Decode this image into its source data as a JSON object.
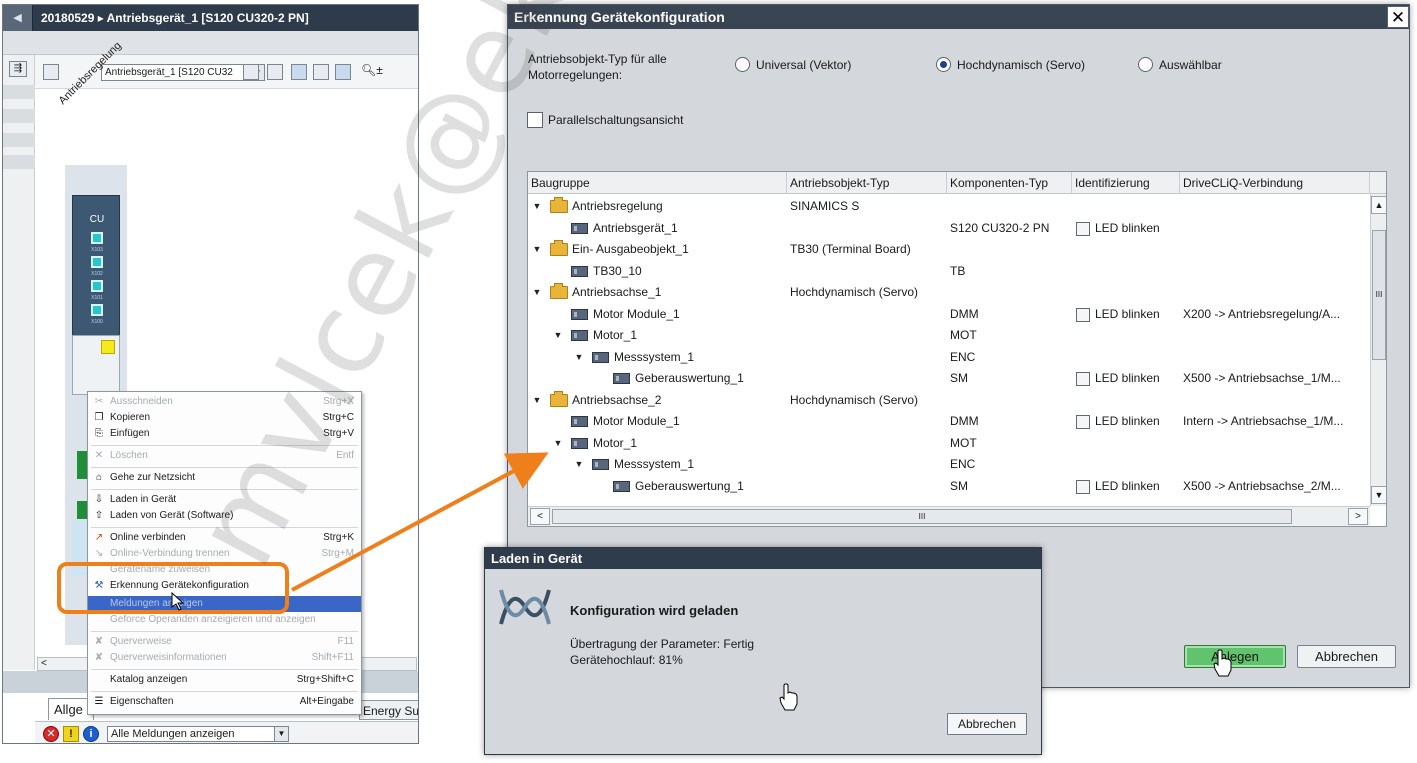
{
  "left_window": {
    "title": "20180529 ▸ Antriebsgerät_1 [S120 CU320-2 PN]",
    "collapse_glyph": "◀",
    "device_select": "Antriebsgerät_1 [S120 CU32",
    "rotated_label": "Antriebsregelung",
    "cu_label": "CU",
    "ports": [
      "X103",
      "X102",
      "X101",
      "X100"
    ],
    "inspector_tab": "Allge",
    "energy_tab": "Energy Su",
    "message_filter": "Alle Meldungen anzeigen",
    "hscroll_left": "<"
  },
  "context_menu": {
    "items": [
      {
        "icon": "✂",
        "label": "Ausschneiden",
        "shortcut": "Strg+X",
        "disabled": true
      },
      {
        "icon": "❐",
        "label": "Kopieren",
        "shortcut": "Strg+C",
        "disabled": false
      },
      {
        "icon": "⎘",
        "label": "Einfügen",
        "shortcut": "Strg+V",
        "disabled": false
      },
      {
        "icon": "✕",
        "label": "Löschen",
        "shortcut": "Entf",
        "disabled": true
      },
      {
        "icon": "⌂",
        "label": "Gehe zur Netzsicht",
        "shortcut": "",
        "disabled": false
      },
      {
        "icon": "⇩",
        "label": "Laden in Gerät",
        "shortcut": "",
        "disabled": false
      },
      {
        "icon": "⇧",
        "label": "Laden von Gerät (Software)",
        "shortcut": "",
        "disabled": false
      },
      {
        "icon": "↗",
        "label": "Online verbinden",
        "shortcut": "Strg+K",
        "disabled": false
      },
      {
        "icon": "↘",
        "label": "Online-Verbindung trennen",
        "shortcut": "Strg+M",
        "disabled": true
      },
      {
        "icon": "",
        "label": "Gerätename zuweisen",
        "shortcut": "",
        "disabled": true
      },
      {
        "icon": "⚒",
        "label": "Erkennung Gerätekonfiguration",
        "shortcut": "",
        "disabled": false
      },
      {
        "icon": "",
        "label": "Meldungen anzeigen",
        "shortcut": "",
        "disabled": true,
        "highlighted": true
      },
      {
        "icon": "",
        "label": "Geforce Operanden anzeigieren und anzeigen",
        "shortcut": "",
        "disabled": true
      },
      {
        "icon": "✘",
        "label": "Querverweise",
        "shortcut": "F11",
        "disabled": true
      },
      {
        "icon": "✘",
        "label": "Querverweisinformationen",
        "shortcut": "Shift+F11",
        "disabled": true
      },
      {
        "icon": "",
        "label": "Katalog anzeigen",
        "shortcut": "Strg+Shift+C",
        "disabled": false
      },
      {
        "icon": "☰",
        "label": "Eigenschaften",
        "shortcut": "Alt+Eingabe",
        "disabled": false
      }
    ]
  },
  "watermark": "mvlcek@ekv",
  "dialog": {
    "title": "Erkennung Gerätekonfiguration",
    "close_glyph": "✕",
    "type_label": "Antriebsobjekt-Typ für alle Motorregelungen:",
    "radios": [
      {
        "label": "Universal (Vektor)",
        "checked": false
      },
      {
        "label": "Hochdynamisch (Servo)",
        "checked": true
      },
      {
        "label": "Auswählbar",
        "checked": false
      }
    ],
    "parallel_label": "Parallelschaltungsansicht",
    "parallel_checked": false,
    "columns": [
      "Baugruppe",
      "Antriebsobjekt-Typ",
      "Komponenten-Typ",
      "Identifizierung",
      "DriveCLiQ-Verbindung"
    ],
    "rows": [
      {
        "level": 0,
        "twisty": "▼",
        "icon": "folder",
        "name": "Antriebsregelung",
        "type": "SINAMICS S",
        "comp": "",
        "ident": "",
        "conn": ""
      },
      {
        "level": 1,
        "twisty": "",
        "icon": "device",
        "name": "Antriebsgerät_1",
        "type": "",
        "comp": "S120 CU320-2 PN",
        "ident": "LED blinken",
        "conn": ""
      },
      {
        "level": 0,
        "twisty": "▼",
        "icon": "folder",
        "name": "Ein- Ausgabeobjekt_1",
        "type": "TB30 (Terminal Board)",
        "comp": "",
        "ident": "",
        "conn": ""
      },
      {
        "level": 1,
        "twisty": "",
        "icon": "device",
        "name": "TB30_10",
        "type": "",
        "comp": "TB",
        "ident": "",
        "conn": ""
      },
      {
        "level": 0,
        "twisty": "▼",
        "icon": "folder",
        "name": "Antriebsachse_1",
        "type": "Hochdynamisch (Servo)",
        "comp": "",
        "ident": "",
        "conn": ""
      },
      {
        "level": 1,
        "twisty": "",
        "icon": "device",
        "name": "Motor Module_1",
        "type": "",
        "comp": "DMM",
        "ident": "LED blinken",
        "conn": "X200 -> Antriebsregelung/A..."
      },
      {
        "level": 1,
        "twisty": "▼",
        "icon": "device",
        "name": "Motor_1",
        "type": "",
        "comp": "MOT",
        "ident": "",
        "conn": ""
      },
      {
        "level": 2,
        "twisty": "▼",
        "icon": "device",
        "name": "Messsystem_1",
        "type": "",
        "comp": "ENC",
        "ident": "",
        "conn": ""
      },
      {
        "level": 3,
        "twisty": "",
        "icon": "device",
        "name": "Geberauswertung_1",
        "type": "",
        "comp": "SM",
        "ident": "LED blinken",
        "conn": "X500 -> Antriebsachse_1/M..."
      },
      {
        "level": 0,
        "twisty": "▼",
        "icon": "folder",
        "name": "Antriebsachse_2",
        "type": "Hochdynamisch (Servo)",
        "comp": "",
        "ident": "",
        "conn": ""
      },
      {
        "level": 1,
        "twisty": "",
        "icon": "device",
        "name": "Motor Module_1",
        "type": "",
        "comp": "DMM",
        "ident": "LED blinken",
        "conn": "Intern -> Antriebsachse_1/M..."
      },
      {
        "level": 1,
        "twisty": "▼",
        "icon": "device",
        "name": "Motor_1",
        "type": "",
        "comp": "MOT",
        "ident": "",
        "conn": ""
      },
      {
        "level": 2,
        "twisty": "▼",
        "icon": "device",
        "name": "Messsystem_1",
        "type": "",
        "comp": "ENC",
        "ident": "",
        "conn": ""
      },
      {
        "level": 3,
        "twisty": "",
        "icon": "device",
        "name": "Geberauswertung_1",
        "type": "",
        "comp": "SM",
        "ident": "LED blinken",
        "conn": "X500 -> Antriebsachse_2/M..."
      }
    ],
    "scroll": {
      "up": "▲",
      "down": "▼",
      "left": "<",
      "right": ">",
      "grip": "III"
    },
    "create_button": "Anlegen",
    "cancel_button": "Abbrechen"
  },
  "laden": {
    "title": "Laden in Gerät",
    "heading": "Konfiguration wird geladen",
    "line1": "Übertragung der Parameter: Fertig",
    "line2": "Gerätehochlauf: 81%",
    "progress_percent": 81,
    "cancel_button": "Abbrechen"
  },
  "colors": {
    "accent_orange": "#ef7f1a",
    "title_bar": "#3a4553",
    "create_green": "#5fc46d",
    "menu_highlight": "#3a66c7"
  }
}
